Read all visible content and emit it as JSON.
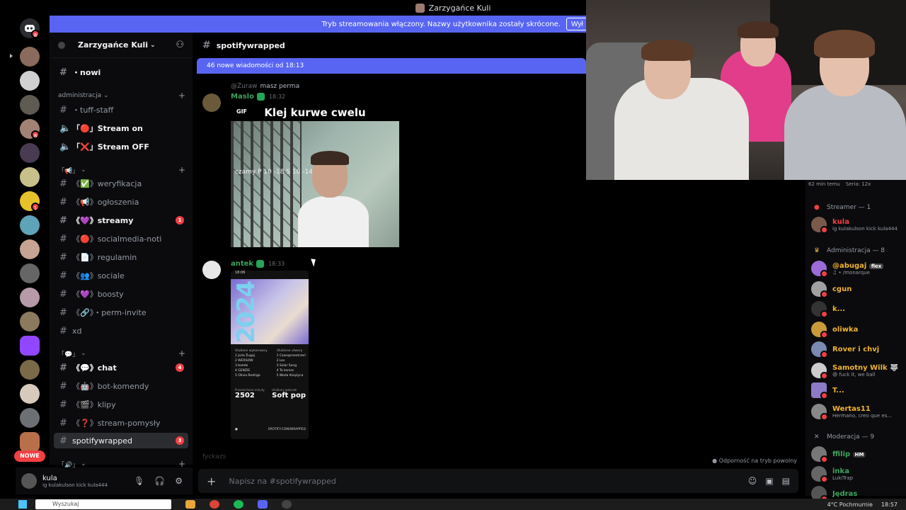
{
  "window": {
    "title": "Zarzygańce Kuli"
  },
  "stream_banner": {
    "text": "Tryb streamowania włączony. Nazwy użytkownika zostały skrócone.",
    "button": "Wył"
  },
  "rail": {
    "nowe_label": "NOWE",
    "badges": [
      "8",
      "8",
      "1"
    ]
  },
  "server": {
    "name": "Zarzygańce Kuli"
  },
  "sidebar": {
    "channels_top": [
      {
        "label": "・nowi"
      }
    ],
    "cat_admin": "administracja",
    "admin_channels": [
      {
        "label": "・tuff-staff"
      },
      {
        "label": "「🔴」Stream on"
      },
      {
        "label": "「❌」Stream OFF"
      }
    ],
    "cat_2": "「📢」",
    "info_channels": [
      {
        "label": "《✅》weryfikacja"
      },
      {
        "label": "《📢》ogłoszenia"
      },
      {
        "label": "《💜》streamy",
        "badge": "1"
      },
      {
        "label": "《🔴》socialmedia-noti"
      },
      {
        "label": "《📄》regulamin"
      },
      {
        "label": "《👥》sociale"
      },
      {
        "label": "《💜》boosty"
      },
      {
        "label": "《🔗》・perm-invite"
      },
      {
        "label": "xd"
      }
    ],
    "cat_3": "「💬」",
    "chat_channels": [
      {
        "label": "《💬》chat",
        "badge": "4"
      },
      {
        "label": "《🤖》bot-komendy"
      },
      {
        "label": "《🎬》klipy"
      },
      {
        "label": "《❓》stream-pomysły"
      },
      {
        "label": "spotifywrapped",
        "badge": "3"
      }
    ],
    "cat_4": "「🔊」"
  },
  "user": {
    "name": "kula",
    "status": "ig kulakulson kick kula444"
  },
  "chat": {
    "channel": "spotifywrapped",
    "new_messages": "46 nowe wiadomości od 18:13",
    "reply_mention": "@Żuraw",
    "reply_text": "masz perma",
    "msg1": {
      "author": "Maslo",
      "time": "18:32",
      "gif_label": "GIF",
      "gif_caption": "Klej kurwe cwelu",
      "sign_text": "czamy P 10 -18 S 10 -14"
    },
    "msg2": {
      "author": "antek",
      "time": "18:33",
      "phone_time": "18:06",
      "year": "2024",
      "artists_header": "Ulubieni wykonawcy",
      "artists": [
        "1 Julia Żugaj",
        "2 WERSOW",
        "3 bambi",
        "4 GENZIE",
        "5 Olivia Rodrigo"
      ],
      "songs_header": "Ulubione utwory",
      "songs": [
        "1 Czasoprzestrzeń",
        "2 Los",
        "3 Solar Song",
        "4 To koniec",
        "5 Woda Księżyca"
      ],
      "minutes_label": "Przesłuchane minuty",
      "minutes": "2502",
      "genre_label": "Ulubiony gatunek",
      "genre": "Soft pop",
      "footer": "SPOTIFY.COM/WRAPPED"
    },
    "typing": "fyckazs",
    "slow_mode": "Odporność na tryb powolny",
    "composer_placeholder": "Napisz na #spotifywrapped"
  },
  "members": {
    "live_info": [
      "62 min temu",
      "Seria: 12x"
    ],
    "groups": [
      {
        "title": "Streamer — 1",
        "icon": "red-dot",
        "items": [
          {
            "name": "kula",
            "status": "ig kulakulson kick kula444",
            "color": "#f23f43"
          }
        ]
      },
      {
        "title": "Administracja — 8",
        "icon": "crown",
        "items": [
          {
            "name": "@abugaj",
            "status": "♫ • /monarque",
            "color": "#f0b232",
            "tag": "flex"
          },
          {
            "name": "cgun",
            "status": "",
            "color": "#f0b232"
          },
          {
            "name": "k...",
            "status": "",
            "color": "#f0b232"
          },
          {
            "name": "oliwka",
            "status": "",
            "color": "#f0b232"
          },
          {
            "name": "Rover i chvj",
            "status": "",
            "color": "#f0b232"
          },
          {
            "name": "Samotny Wilk 🐺",
            "status": "😄 fuck it, we ball",
            "color": "#f0b232"
          },
          {
            "name": "T...",
            "status": "",
            "color": "#f0b232"
          },
          {
            "name": "Wertas11",
            "status": "Hermano, creo que es...",
            "color": "#f0b232"
          }
        ]
      },
      {
        "title": "Moderacja — 9",
        "icon": "tools",
        "items": [
          {
            "name": "ffilip",
            "status": "",
            "color": "#3ba55c",
            "tag": "HM"
          },
          {
            "name": "inka",
            "status": "LukiTrap",
            "color": "#3ba55c"
          },
          {
            "name": "Jędras",
            "status": "",
            "color": "#3ba55c"
          }
        ]
      }
    ]
  },
  "taskbar": {
    "search_placeholder": "Wyszukaj",
    "weather": "4°C Pochmurnie",
    "time": "18:57"
  }
}
